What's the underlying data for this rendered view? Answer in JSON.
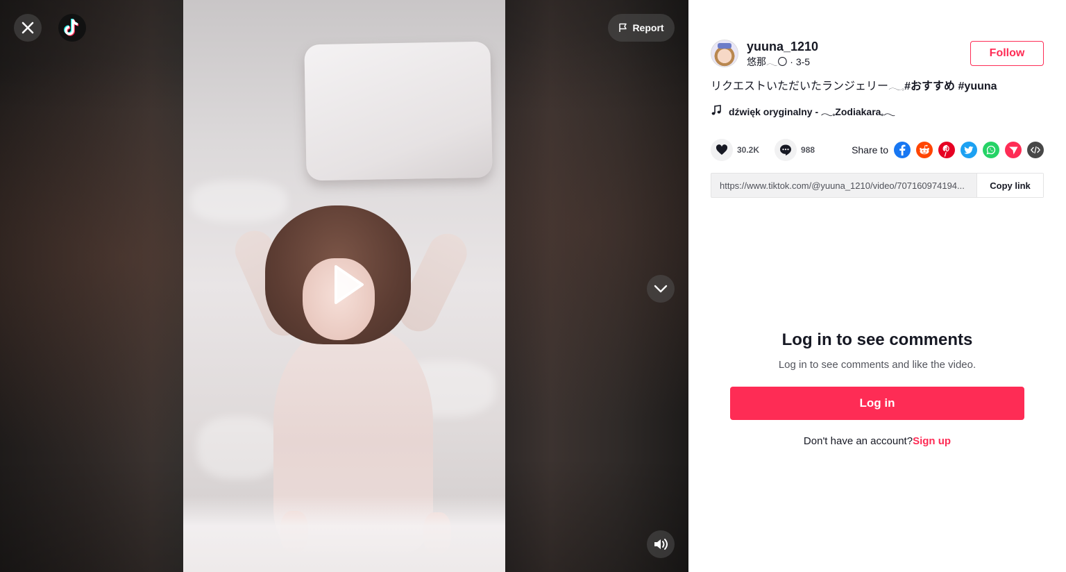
{
  "video": {
    "report_label": "Report"
  },
  "author": {
    "username": "yuuna_1210",
    "nickname": "悠那𓂃〇",
    "date": "3-5",
    "follow_label": "Follow"
  },
  "post": {
    "caption_text": "リクエストいただいたランジェリー𓂃𓈒",
    "hashtags": [
      "#おすすめ",
      "#yuuna"
    ],
    "music": "dźwięk oryginalny - 𓂃𓈒Zodiakara𓈒𓂃"
  },
  "stats": {
    "likes": "30.2K",
    "comments": "988"
  },
  "share": {
    "label": "Share to",
    "icons": [
      {
        "name": "facebook-icon",
        "color": "#1877f2"
      },
      {
        "name": "reddit-icon",
        "color": "#ff4500"
      },
      {
        "name": "pinterest-icon",
        "color": "#e60023"
      },
      {
        "name": "twitter-icon",
        "color": "#1da1f2"
      },
      {
        "name": "whatsapp-icon",
        "color": "#25d366"
      },
      {
        "name": "send-icon",
        "color": "#fe2c55"
      },
      {
        "name": "embed-icon",
        "color": "#474747"
      }
    ]
  },
  "link": {
    "url": "https://www.tiktok.com/@yuuna_1210/video/707160974194...",
    "copy_label": "Copy link"
  },
  "comments_gate": {
    "title": "Log in to see comments",
    "subtitle": "Log in to see comments and like the video.",
    "login_label": "Log in",
    "no_account_text": "Don't have an account?",
    "signup_label": "Sign up"
  },
  "colors": {
    "accent": "#fe2c55",
    "text": "#161823"
  }
}
